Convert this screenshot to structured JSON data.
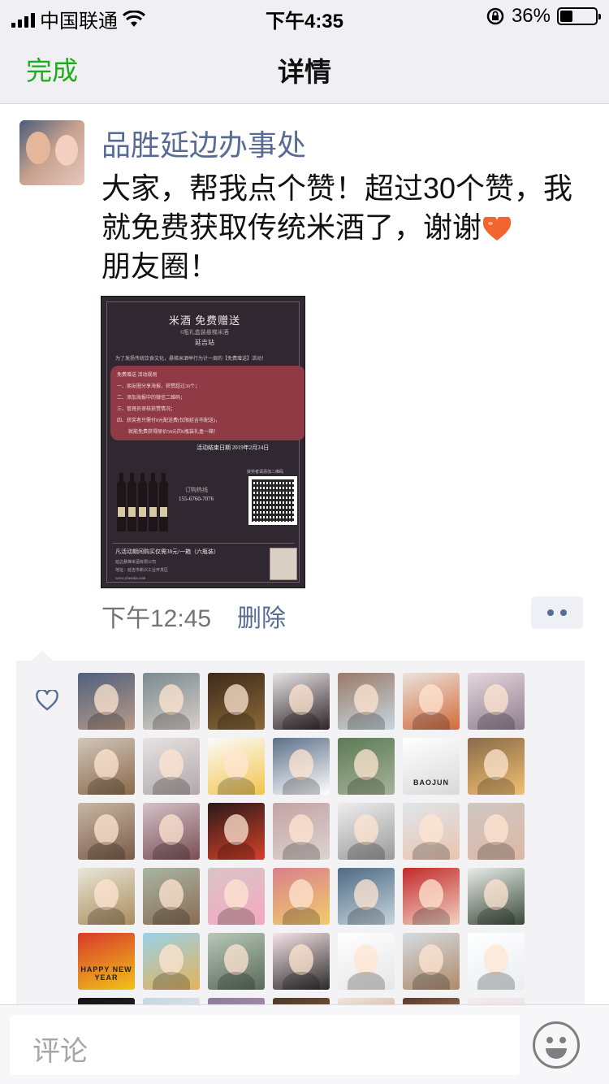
{
  "status_bar": {
    "carrier": "中国联通",
    "time": "下午4:35",
    "battery_percent": "36%",
    "battery_level": 0.36
  },
  "nav": {
    "done_label": "完成",
    "title": "详情"
  },
  "post": {
    "author": "品胜延边办事处",
    "text": "大家，帮我点个赞！超过30个赞，我就免费获取传统米酒了，谢谢",
    "text_suffix": "朋友圈！",
    "time": "下午12:45",
    "delete_label": "删除",
    "poster": {
      "title": "米酒 免费赠送",
      "subtitle": "6瓶礼盒装悬梯米酒",
      "location": "延吉站",
      "intro": "为了发扬传统饮食文化，悬梯米酒举行为计一周的【免费赠送】活动！",
      "rules": [
        "免费赠送 活动规则",
        "一、朋友圈分享海报，获赞超过30个；",
        "二、添加海报中的微信二维码；",
        "三、管理员审核获赞情况；",
        "四、获奖者只需付8元配送费(仅限延吉市配送)，",
        "就能免费获得原价58元的6瓶装礼盒一箱！"
      ],
      "deadline": "活动结束日期 2019年2月24日",
      "hotline_label": "订购热线",
      "phone": "155-6760-7076",
      "qr_label": "获奖者请添加二维码",
      "footer_price": "凡活动期间购买仅需38元/一箱（六瓶装）",
      "footer_company": "延边悬梯米酒有限公司",
      "footer_address": "地址：延吉市新兴工业开发区",
      "footer_site": "www.yheoma.com"
    }
  },
  "likes": {
    "count": 42,
    "avatar_colors": [
      [
        "#4f607c",
        "#b99a8a"
      ],
      [
        "#7a8a90",
        "#d8cfc8"
      ],
      [
        "#3d2a1a",
        "#8b6a3a"
      ],
      [
        "#e8e4e6",
        "#2e2528"
      ],
      [
        "#9b7a6a",
        "#c6d7de"
      ],
      [
        "#e9e3dc",
        "#d56a3a"
      ],
      [
        "#e5d6de",
        "#8f7e8e"
      ],
      [
        "#d2c6bb",
        "#8a6a4a"
      ],
      [
        "#e8e2e3",
        "#b0a8aa"
      ],
      [
        "#fbfbfb",
        "#f2c54a"
      ],
      [
        "#5d6f88",
        "#ffffff"
      ],
      [
        "#5d7a55",
        "#a6b49a"
      ],
      [
        "#ffffff",
        "#d9d9d9"
      ],
      [
        "#8a6a4a",
        "#f0c070"
      ],
      [
        "#c7b8a3",
        "#7a5b4a"
      ],
      [
        "#d3c2c8",
        "#7a4e55"
      ],
      [
        "#2a1a1a",
        "#d6412a"
      ],
      [
        "#c4a3a4",
        "#dcd3d0"
      ],
      [
        "#eeeeee",
        "#9a9a9a"
      ],
      [
        "#dfe5ea",
        "#e9c4b0"
      ],
      [
        "#cfc6c2",
        "#dcb8a6"
      ],
      [
        "#e9e6d8",
        "#aa8c5e"
      ],
      [
        "#a9b6a3",
        "#8a6b55"
      ],
      [
        "#dac5c7",
        "#f4a8c0"
      ],
      [
        "#d9808c",
        "#f2cc6a"
      ],
      [
        "#4f6b86",
        "#c7d4dd"
      ],
      [
        "#c22a2a",
        "#f2d2c2"
      ],
      [
        "#e8ece8",
        "#3a4a3a"
      ],
      [
        "#d83a2a",
        "#f2c21a"
      ],
      [
        "#9ad1e8",
        "#e2b35a"
      ],
      [
        "#b8c8b8",
        "#5a6a5a"
      ],
      [
        "#f7e4e8",
        "#2a2a2a"
      ],
      [
        "#ffffff",
        "#e6e6e6"
      ],
      [
        "#d6dbe0",
        "#ae8a6a"
      ],
      [
        "#ffffff",
        "#e9eef2"
      ],
      [
        "#151515",
        "#2a2a2a"
      ],
      [
        "#c7d6e0",
        "#f2f2f2"
      ],
      [
        "#8d7b96",
        "#c0a6c0"
      ],
      [
        "#4a3a2a",
        "#a66a3a"
      ],
      [
        "#efe6de",
        "#b88a6a"
      ],
      [
        "#5a3a2a",
        "#d2a282"
      ],
      [
        "#f3ecec",
        "#e2d6d6"
      ]
    ],
    "labels": {
      "12": "BAOJUN",
      "28": "HAPPY NEW YEAR"
    }
  },
  "comment": {
    "placeholder": "评论"
  },
  "colors": {
    "link": "#576b95",
    "done_green": "#1aad19",
    "likes_bg": "#f3f3f5"
  }
}
